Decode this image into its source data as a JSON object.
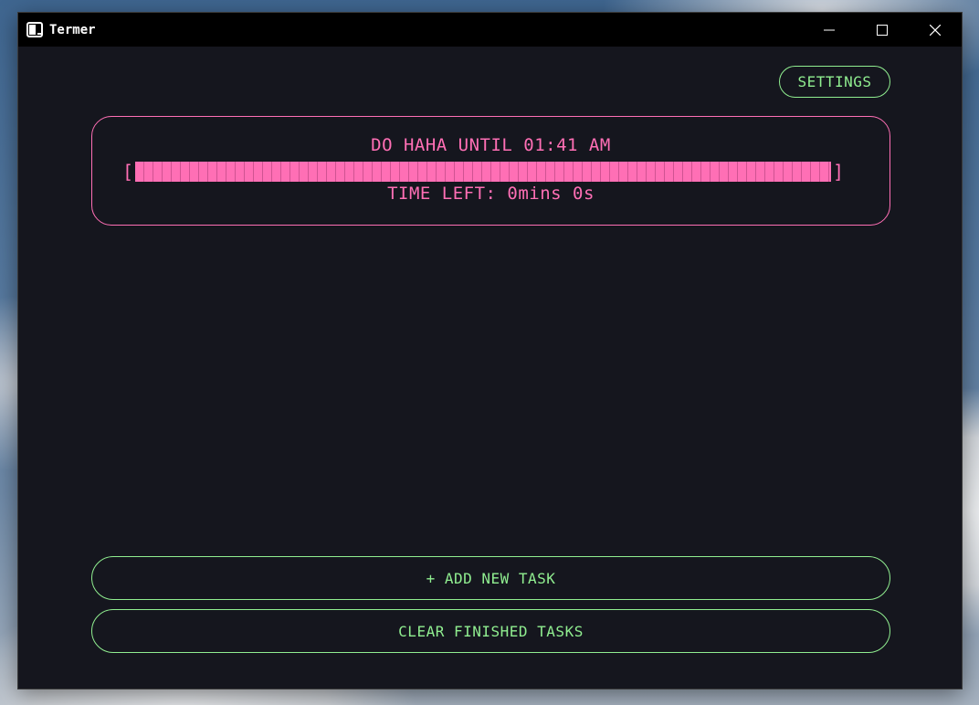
{
  "window": {
    "title": "Termer",
    "controls": {
      "minimize": "minimize-icon",
      "maximize": "maximize-icon",
      "close": "close-icon"
    }
  },
  "toolbar": {
    "settings_label": "SETTINGS"
  },
  "task": {
    "title": "DO HAHA UNTIL 01:41 AM",
    "bracket_open": "[",
    "bracket_close": "]",
    "progress_fraction": 1.0,
    "time_left": "TIME LEFT: 0mins 0s"
  },
  "actions": {
    "add_label": "+ ADD NEW TASK",
    "clear_label": "CLEAR FINISHED TASKS"
  },
  "colors": {
    "background": "#15161e",
    "accent_green": "#90ee90",
    "accent_pink": "#ff6fb5",
    "titlebar": "#000000"
  }
}
